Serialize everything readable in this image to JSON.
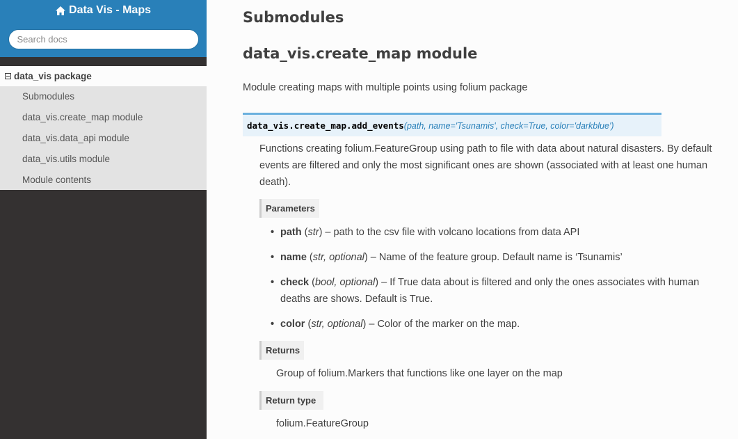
{
  "sidebar": {
    "project_title": "Data Vis - Maps",
    "search_placeholder": "Search docs",
    "current": "data_vis package",
    "items": [
      {
        "label": "Submodules"
      },
      {
        "label": "data_vis.create_map module"
      },
      {
        "label": "data_vis.data_api module"
      },
      {
        "label": "data_vis.utils module"
      },
      {
        "label": "Module contents"
      }
    ]
  },
  "main": {
    "heading_submodules": "Submodules",
    "heading_module": "data_vis.create_map module",
    "module_description": "Module creating maps with multiple points using folium package",
    "signature": {
      "name": "data_vis.create_map.add_events",
      "params": "(path, name='Tsunamis', check=True, color='darkblue')"
    },
    "function_description": "Functions creating folium.FeatureGroup using path to file with data about natural disasters. By default events are filtered and only the most significant ones are shown (associated with at least one human death).",
    "fields": {
      "parameters_label": "Parameters",
      "returns_label": "Returns",
      "return_type_label": "Return type"
    },
    "parameters": [
      {
        "name": "path",
        "type": "str",
        "desc": "path to the csv file with volcano locations from data API"
      },
      {
        "name": "name",
        "type": "str, optional",
        "desc": "Name of the feature group. Default name is ‘Tsunamis’"
      },
      {
        "name": "check",
        "type": "bool, optional",
        "desc": "If True data about is filtered and only the ones associates with human deaths are shows. Default is True."
      },
      {
        "name": "color",
        "type": "str, optional",
        "desc": "Color of the marker on the map."
      }
    ],
    "returns": "Group of folium.Markers that functions like one layer on the map",
    "return_type": "folium.FeatureGroup"
  },
  "colors": {
    "sidebar_bg": "#343131",
    "sidebar_top": "#2980b9",
    "signature_bg": "#e7f2fa",
    "signature_border": "#6ab0de",
    "param_link": "#2980b9"
  },
  "icons": [
    "home-icon",
    "collapse-icon"
  ]
}
